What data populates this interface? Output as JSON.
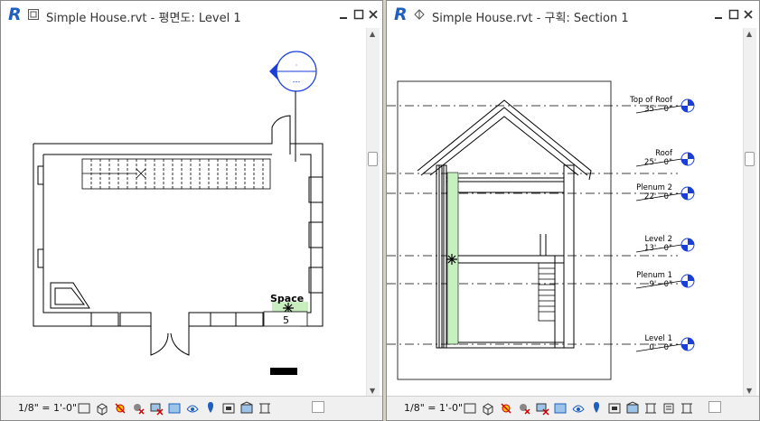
{
  "left_view": {
    "app_icon": "R",
    "title": "Simple House.rvt - 평면도: Level 1",
    "scale": "1/8\" = 1'-0\"",
    "space_label": "Space",
    "space_number": "5",
    "elevation_marker_top": "·",
    "elevation_marker_bottom": "---"
  },
  "right_view": {
    "app_icon": "R",
    "title": "Simple House.rvt - 구획: Section 1",
    "scale": "1/8\" = 1'-0\"",
    "levels": [
      {
        "name": "Top of Roof",
        "elevation": "35' - 0\""
      },
      {
        "name": "Roof",
        "elevation": "25' - 0\""
      },
      {
        "name": "Plenum 2",
        "elevation": "22' - 0\""
      },
      {
        "name": "Level 2",
        "elevation": "13' - 0\""
      },
      {
        "name": "Plenum 1",
        "elevation": "9' - 0\""
      },
      {
        "name": "Level 1",
        "elevation": "0' - 0\""
      }
    ]
  },
  "icons": {
    "view_controls": [
      "detail-level-icon",
      "visual-style-icon",
      "sun-path-icon",
      "shadows-icon",
      "crop-view-icon",
      "show-crop-icon",
      "temporary-hide-icon",
      "reveal-hidden-icon",
      "analytical-model-icon",
      "highlight-displacement-icon",
      "reveal-constraints-icon"
    ]
  },
  "colors": {
    "app_blue": "#1f5fbf",
    "marker_blue": "#1a3fd6",
    "space_fill": "#c8eec0",
    "insulation_green": "#c6f0c0"
  }
}
